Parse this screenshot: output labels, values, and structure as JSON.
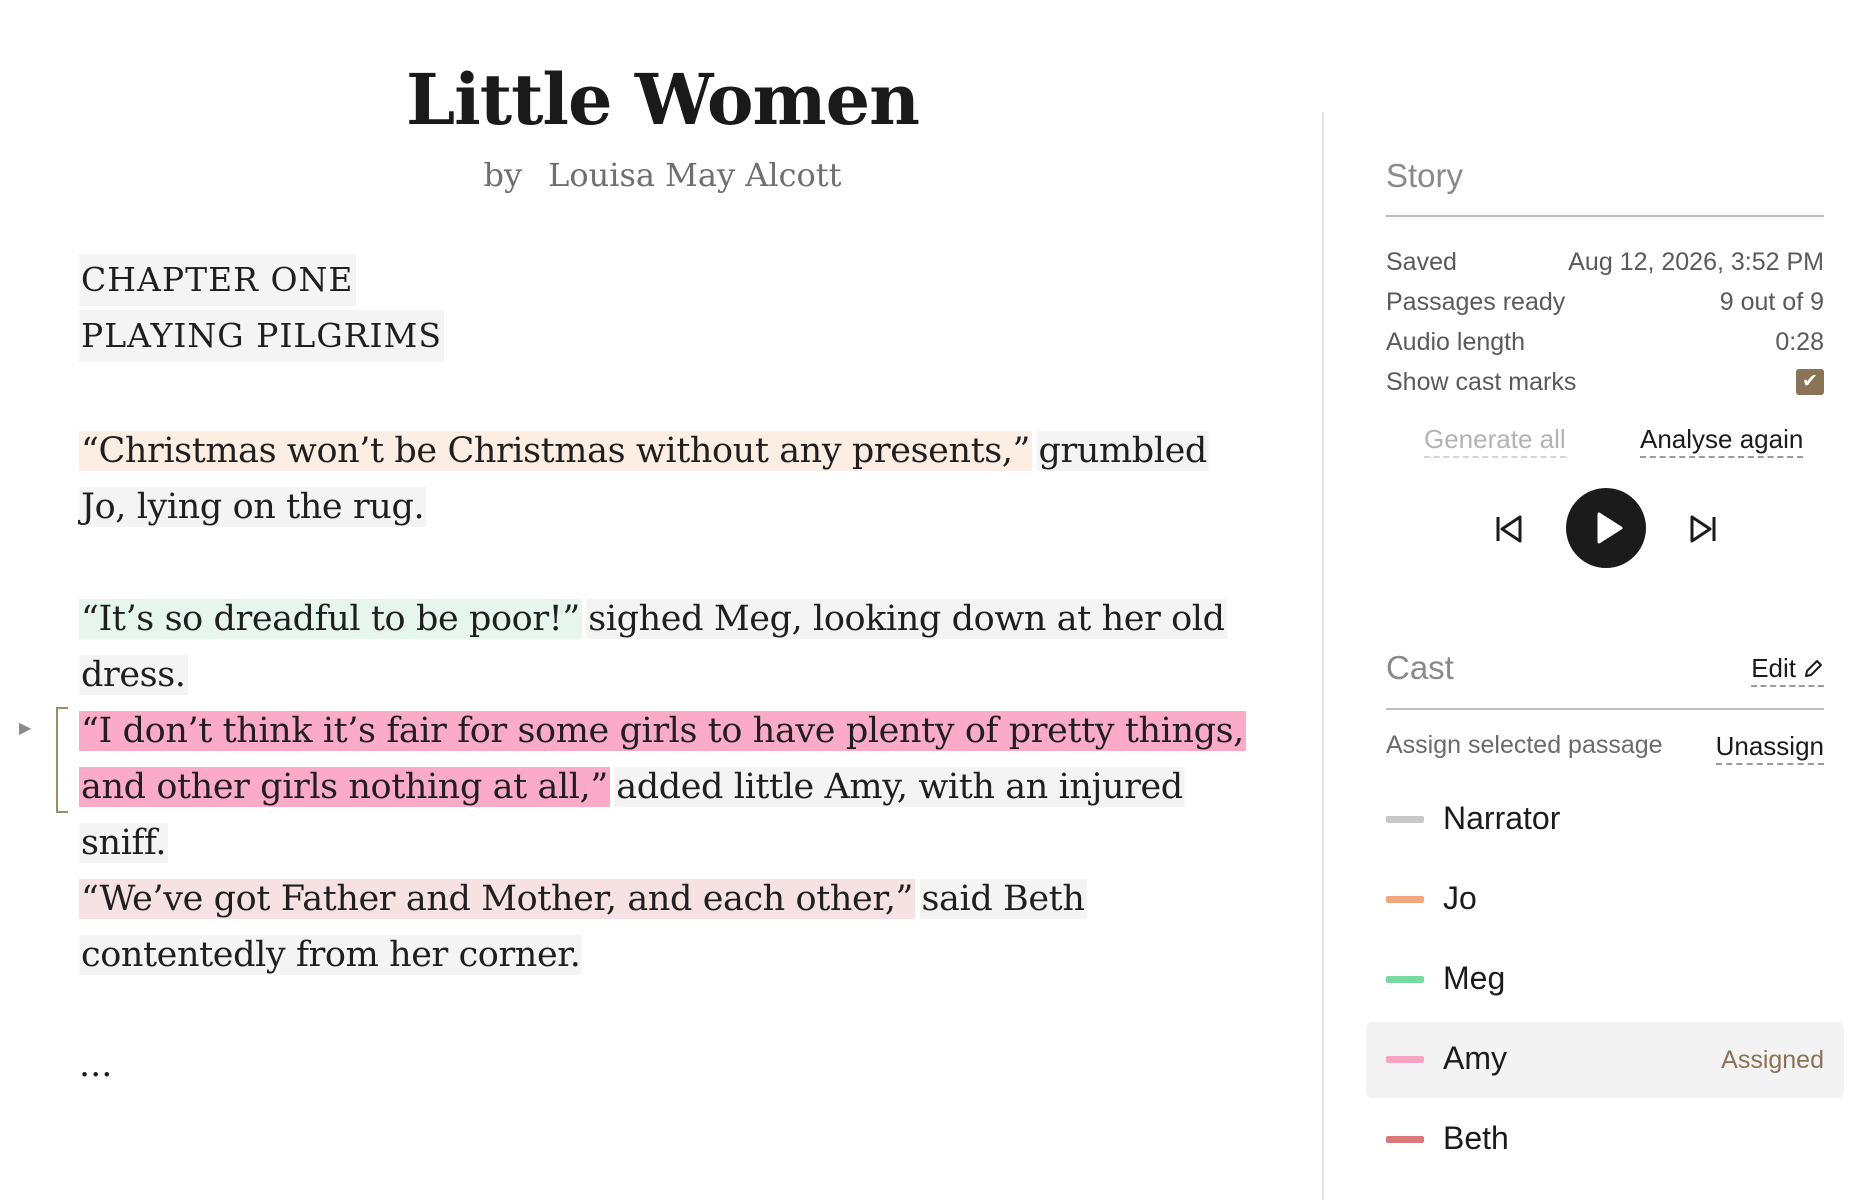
{
  "book": {
    "title": "Little Women",
    "by_label": "by",
    "author": "Louisa May Alcott"
  },
  "chapter": {
    "number": "CHAPTER ONE",
    "name": "PLAYING PILGRIMS"
  },
  "passages": [
    {
      "quote": "“Christmas won’t be Christmas without any presents,”",
      "narration": "grumbled Jo, lying on the rug.",
      "speaker": "Jo"
    },
    {
      "quote": "“It’s so dreadful to be poor!”",
      "narration": "sighed Meg, looking down at her old dress.",
      "speaker": "Meg"
    },
    {
      "quote": "“I don’t think it’s fair for some girls to have plenty of pretty things, and other girls nothing at all,”",
      "narration": "added little Amy, with an injured sniff.",
      "speaker": "Amy"
    },
    {
      "quote": "“We’ve got Father and Mother, and each other,”",
      "narration": "said Beth contentedly from her corner.",
      "speaker": "Beth"
    }
  ],
  "ellipsis": "...",
  "story": {
    "heading": "Story",
    "saved_label": "Saved",
    "saved_value": "Aug 12, 2026, 3:52 PM",
    "passages_label": "Passages ready",
    "passages_value": "9 out of 9",
    "audio_label": "Audio length",
    "audio_value": "0:28",
    "cast_marks_label": "Show cast marks",
    "cast_marks_checked": true,
    "generate_all": "Generate all",
    "analyse_again": "Analyse again"
  },
  "cast": {
    "heading": "Cast",
    "edit_label": "Edit",
    "assign_label": "Assign selected passage",
    "unassign_label": "Unassign",
    "members": [
      {
        "name": "Narrator",
        "color": "#c8c8c8",
        "tag": ""
      },
      {
        "name": "Jo",
        "color": "#f4a77c",
        "tag": ""
      },
      {
        "name": "Meg",
        "color": "#79d9a2",
        "tag": ""
      },
      {
        "name": "Amy",
        "color": "#f9a3c3",
        "tag": "Assigned"
      },
      {
        "name": "Beth",
        "color": "#d97979",
        "tag": ""
      }
    ]
  },
  "colors": {
    "accent": "#8b7355",
    "narrator_bg": "#f4f4f4",
    "jo_bg": "#fdeee3",
    "meg_bg": "#e6f6ec",
    "amy_bg": "#fbaac8",
    "beth_bg": "#f6e2e2"
  }
}
